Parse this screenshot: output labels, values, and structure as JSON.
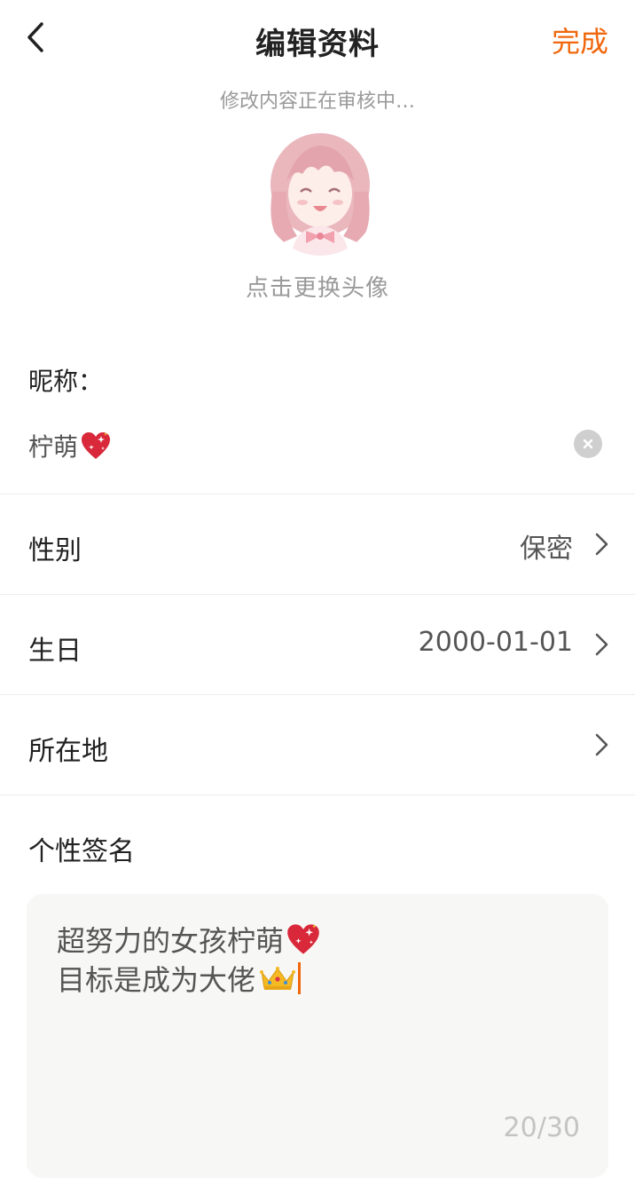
{
  "header": {
    "title": "编辑资料",
    "done_label": "完成",
    "back_icon": "chevron-left-icon"
  },
  "review_note": "修改内容正在审核中…",
  "avatar": {
    "hint": "点击更换头像"
  },
  "nickname": {
    "label": "昵称：",
    "value": "柠萌",
    "emoji": "sparkling-heart-icon",
    "clear_icon": "clear-circle-icon"
  },
  "rows": {
    "gender": {
      "label": "性别",
      "value": "保密"
    },
    "birthday": {
      "label": "生日",
      "value": "2000-01-01"
    },
    "location": {
      "label": "所在地",
      "value": ""
    }
  },
  "signature": {
    "label": "个性签名",
    "line1": "超努力的女孩柠萌",
    "line2": "目标是成为大佬",
    "line1_emoji": "sparkling-heart-icon",
    "line2_emoji": "crown-icon",
    "count": "20/30"
  },
  "colors": {
    "accent": "#f0670d",
    "divider": "#ececec",
    "input_bg": "#f7f7f5"
  }
}
